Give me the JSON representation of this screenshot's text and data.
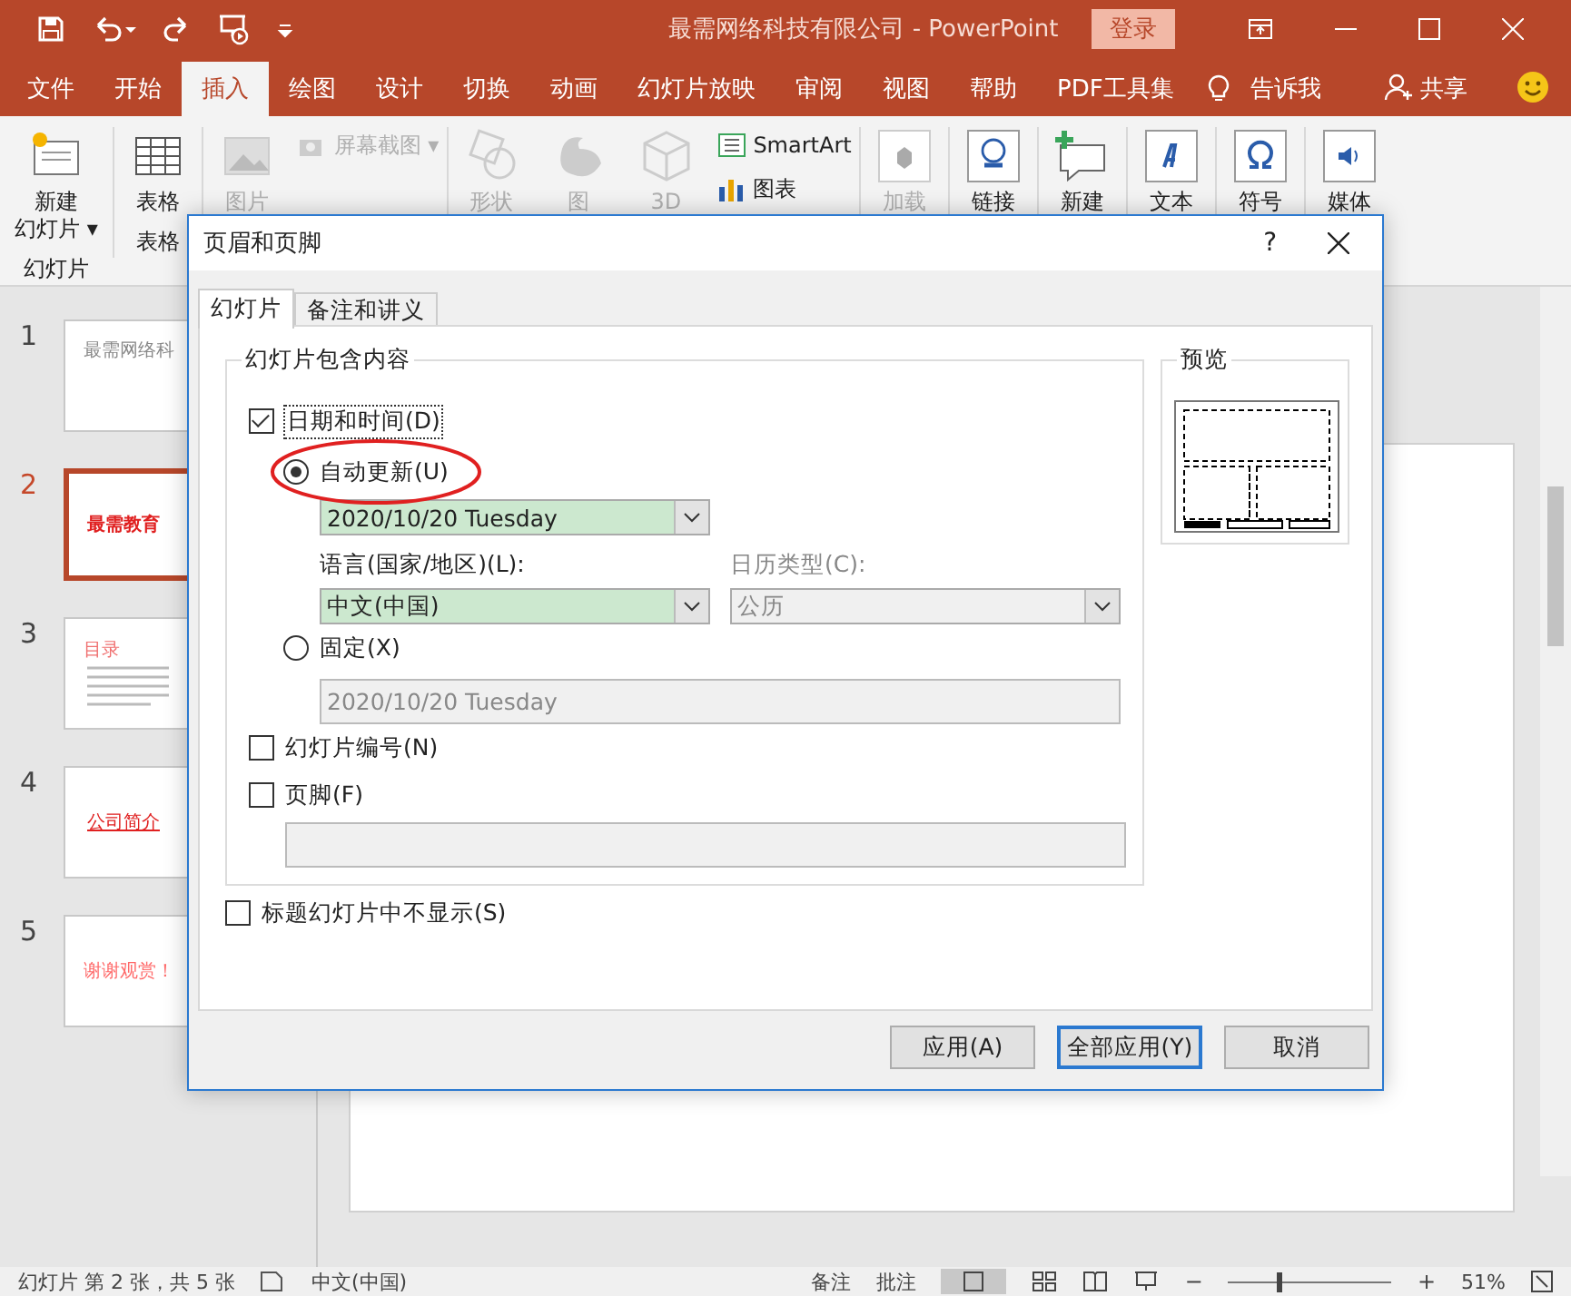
{
  "window": {
    "title": "最需网络科技有限公司  -  PowerPoint",
    "sign_in": "登录"
  },
  "tabs": [
    {
      "label": "文件",
      "selected": false
    },
    {
      "label": "开始",
      "selected": false
    },
    {
      "label": "插入",
      "selected": true
    },
    {
      "label": "绘图",
      "selected": false
    },
    {
      "label": "设计",
      "selected": false
    },
    {
      "label": "切换",
      "selected": false
    },
    {
      "label": "动画",
      "selected": false
    },
    {
      "label": "幻灯片放映",
      "selected": false
    },
    {
      "label": "审阅",
      "selected": false
    },
    {
      "label": "视图",
      "selected": false
    },
    {
      "label": "帮助",
      "selected": false
    },
    {
      "label": "PDF工具集",
      "selected": false
    }
  ],
  "tell_me": "告诉我",
  "share": "共享",
  "ribbon": [
    {
      "kind": "large",
      "lines": [
        "新建",
        "幻灯片 ▾"
      ],
      "group": "幻灯片",
      "disabled": false
    },
    {
      "kind": "large",
      "lines": [
        "表格"
      ],
      "group": "表格",
      "disabled": false
    },
    {
      "kind": "large",
      "lines": [
        "图片"
      ],
      "disabled": true
    },
    {
      "kind": "stack",
      "items": [
        {
          "label": "屏幕截图 ▾",
          "disabled": true
        }
      ]
    },
    {
      "kind": "large",
      "lines": [
        "形状"
      ],
      "disabled": true
    },
    {
      "kind": "large",
      "lines": [
        "图"
      ],
      "disabled": true
    },
    {
      "kind": "large",
      "lines": [
        "3D"
      ],
      "disabled": true
    },
    {
      "kind": "stack",
      "items": [
        {
          "label": "SmartArt",
          "disabled": false
        },
        {
          "label": "图表",
          "disabled": false
        }
      ]
    },
    {
      "kind": "large",
      "lines": [
        "加载"
      ],
      "disabled": true
    },
    {
      "kind": "large",
      "lines": [
        "链接"
      ],
      "disabled": false
    },
    {
      "kind": "large",
      "lines": [
        "新建"
      ],
      "disabled": false
    },
    {
      "kind": "large",
      "lines": [
        "文本"
      ],
      "disabled": false
    },
    {
      "kind": "large",
      "lines": [
        "符号"
      ],
      "disabled": false
    },
    {
      "kind": "large",
      "lines": [
        "媒体"
      ],
      "disabled": false
    }
  ],
  "slides": [
    {
      "number": "1",
      "selected": false,
      "title": "最需网络科"
    },
    {
      "number": "2",
      "selected": true,
      "title": "最需教育"
    },
    {
      "number": "3",
      "selected": false,
      "title": "目录"
    },
    {
      "number": "4",
      "selected": false,
      "title": "公司简介"
    },
    {
      "number": "5",
      "selected": false,
      "title": "谢谢观赏！"
    }
  ],
  "dialog": {
    "title": "页眉和页脚",
    "help": "?",
    "tabs": [
      {
        "label": "幻灯片",
        "selected": true
      },
      {
        "label": "备注和讲义",
        "selected": false
      }
    ],
    "group_title": "幻灯片包含内容",
    "date_time": {
      "label": "日期和时间(D)",
      "checked": true
    },
    "auto_update": {
      "label": "自动更新(U)",
      "selected": true,
      "value": "2020/10/20 Tuesday"
    },
    "language": {
      "label": "语言(国家/地区)(L):",
      "value": "中文(中国)"
    },
    "calendar": {
      "label": "日历类型(C):",
      "value": "公历",
      "disabled": true
    },
    "fixed": {
      "label": "固定(X)",
      "selected": false,
      "value": "2020/10/20 Tuesday"
    },
    "slide_number": {
      "label": "幻灯片编号(N)",
      "checked": false
    },
    "footer": {
      "label": "页脚(F)",
      "checked": false
    },
    "no_title_slide": {
      "label": "标题幻灯片中不显示(S)",
      "checked": false
    },
    "preview_title": "预览",
    "buttons": [
      {
        "label": "应用(A)",
        "default": false
      },
      {
        "label": "全部应用(Y)",
        "default": true
      },
      {
        "label": "取消",
        "default": false
      }
    ]
  },
  "status": {
    "slide_info": "幻灯片 第 2 张，共 5 张",
    "language": "中文(中国)",
    "notes": "备注",
    "comments": "批注",
    "zoom_out": "−",
    "zoom_slider": {
      "level": 0.3
    },
    "zoom_in": "+",
    "zoom": "51%"
  }
}
